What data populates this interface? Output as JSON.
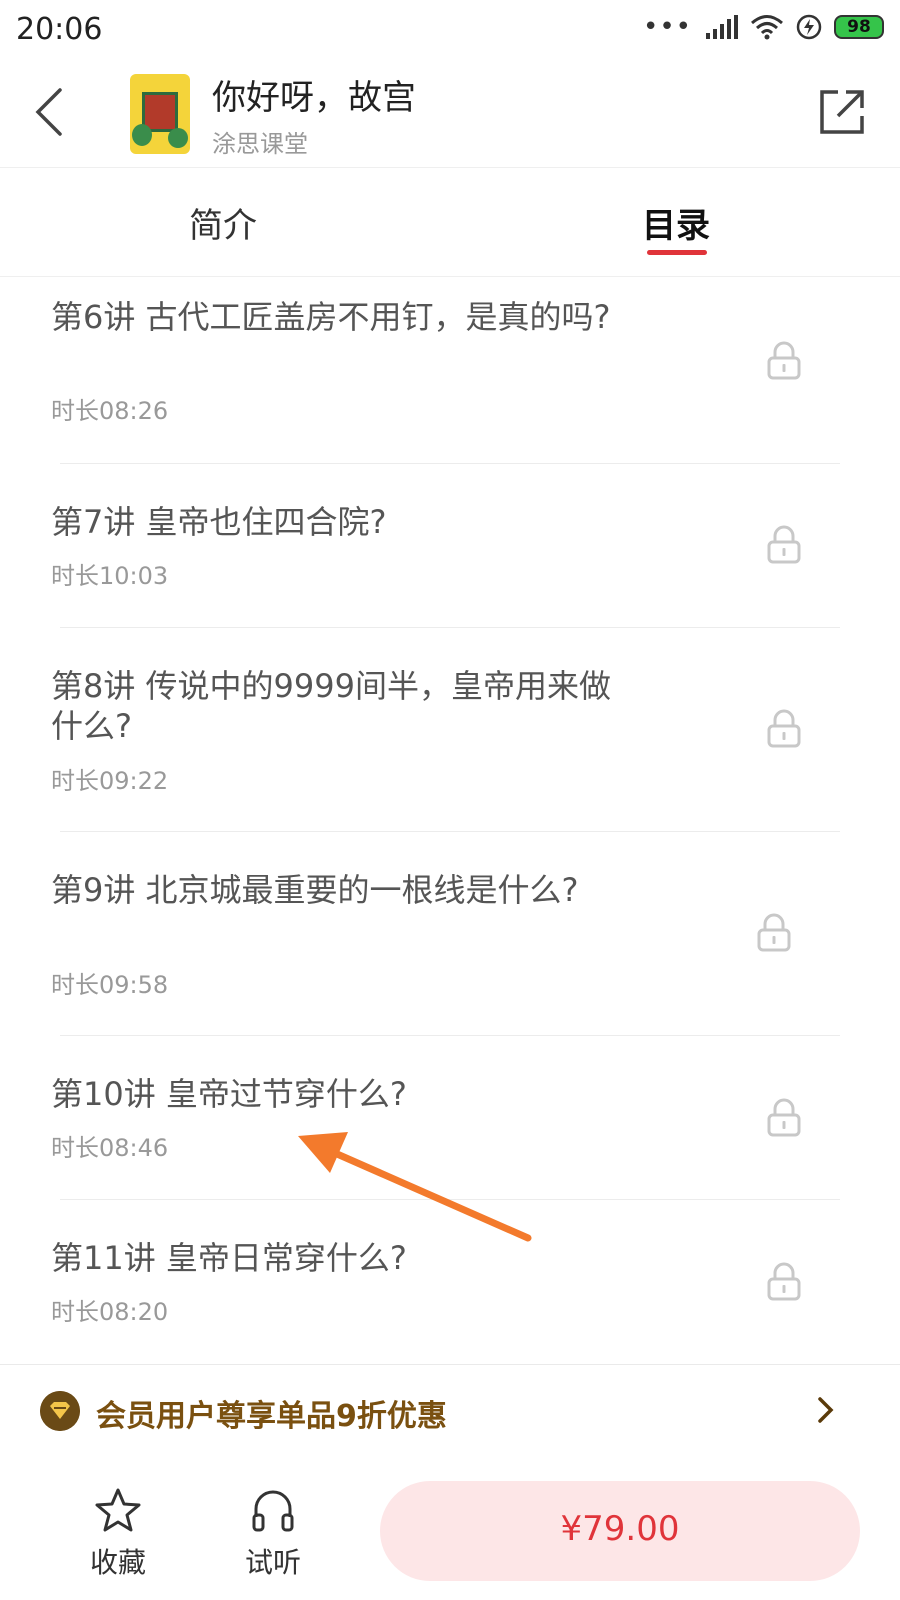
{
  "status_bar": {
    "time": "20:06",
    "dots": "•••",
    "battery": "98"
  },
  "header": {
    "title": "你好呀，故宫",
    "subtitle": "涂思课堂"
  },
  "tabs": [
    {
      "label": "简介"
    },
    {
      "label": "目录"
    }
  ],
  "lessons": [
    {
      "title": "第6讲 古代工匠盖房不用钉，是真的吗?",
      "duration": "时长08:26"
    },
    {
      "title": "第7讲 皇帝也住四合院?",
      "duration": "时长10:03"
    },
    {
      "title": "第8讲 传说中的9999间半，皇帝用来做什么?",
      "duration": "时长09:22"
    },
    {
      "title": "第9讲 北京城最重要的一根线是什么?",
      "duration": "时长09:58"
    },
    {
      "title": "第10讲 皇帝过节穿什么?",
      "duration": "时长08:46"
    },
    {
      "title": "第11讲 皇帝日常穿什么?",
      "duration": "时长08:20"
    }
  ],
  "member_bar": {
    "text": "会员用户尊享单品9折优惠"
  },
  "bottom_bar": {
    "favorite_label": "收藏",
    "listen_label": "试听",
    "price": "¥79.00"
  },
  "colors": {
    "accent": "#e0343a",
    "member_gold": "#7a5010",
    "buy_bg": "#fde6e7",
    "annotation_arrow": "#f37a2c"
  },
  "icons": [
    "back-arrow-icon",
    "share-icon",
    "lock-icon",
    "member-badge-icon",
    "chevron-right-icon",
    "star-icon",
    "headphones-icon",
    "wifi-icon",
    "signal-icon",
    "charging-icon",
    "battery-icon"
  ]
}
